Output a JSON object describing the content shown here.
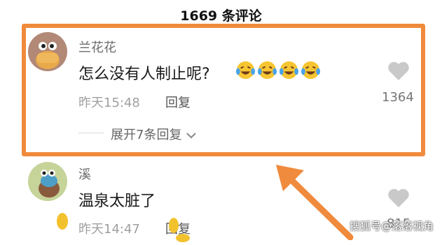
{
  "header": {
    "title": "1669 条评论"
  },
  "comments": [
    {
      "user": "兰花花",
      "text": "怎么没有人制止呢?",
      "time": "昨天15:48",
      "reply_label": "回复",
      "likes": "1364",
      "emojis": [
        "laughing-tears-emoji",
        "laughing-tears-emoji",
        "laughing-tears-emoji",
        "laughing-tears-emoji"
      ],
      "expand_label": "展开7条回复"
    },
    {
      "user": "溪",
      "text": "温泉太脏了",
      "time": "昨天14:47",
      "reply_label": "回复",
      "likes": "815"
    }
  ],
  "watermark": "搜狐号@落落视角",
  "colors": {
    "highlight": "#f08a3c",
    "arrow": "#f08a3c"
  }
}
